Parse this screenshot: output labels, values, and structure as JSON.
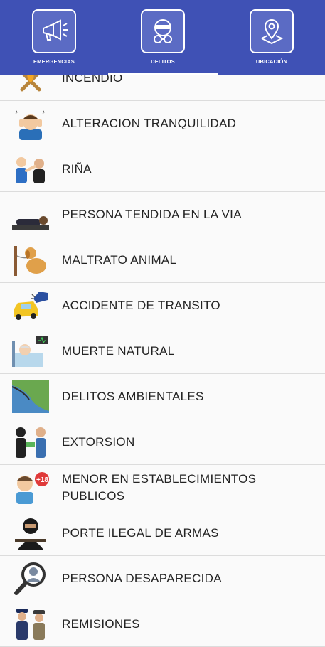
{
  "tabs": [
    {
      "label": "EMERGENCIAS",
      "icon": "megaphone-icon"
    },
    {
      "label": "DELITOS",
      "icon": "masked-thief-icon"
    },
    {
      "label": "UBICACIÓN",
      "icon": "map-pin-icon"
    }
  ],
  "active_tab": "DELITOS",
  "items": [
    {
      "label": "INCENDIO",
      "icon": "fire-icon"
    },
    {
      "label": " ALTERACION TRANQUILIDAD",
      "icon": "noise-disturbance-icon"
    },
    {
      "label": "RIÑA",
      "icon": "fight-icon"
    },
    {
      "label": "PERSONA TENDIDA EN LA VIA",
      "icon": "person-lying-icon"
    },
    {
      "label": "MALTRATO ANIMAL",
      "icon": "tied-dog-icon"
    },
    {
      "label": "ACCIDENTE DE TRANSITO",
      "icon": "car-crash-icon"
    },
    {
      "label": "MUERTE NATURAL",
      "icon": "hospital-bed-icon"
    },
    {
      "label": "DELITOS AMBIENTALES",
      "icon": "landscape-icon"
    },
    {
      "label": "EXTORSION",
      "icon": "extortion-icon"
    },
    {
      "label": "MENOR EN ESTABLECIMIENTOS PUBLICOS",
      "icon": "minor-plus-18-icon"
    },
    {
      "label": "PORTE ILEGAL DE ARMAS",
      "icon": "armed-person-icon"
    },
    {
      "label": "PERSONA DESAPARECIDA",
      "icon": "missing-person-icon"
    },
    {
      "label": "REMISIONES",
      "icon": "police-officers-icon"
    }
  ],
  "colors": {
    "header": "#3f51b5",
    "background": "#fafafa",
    "text": "#222222"
  }
}
